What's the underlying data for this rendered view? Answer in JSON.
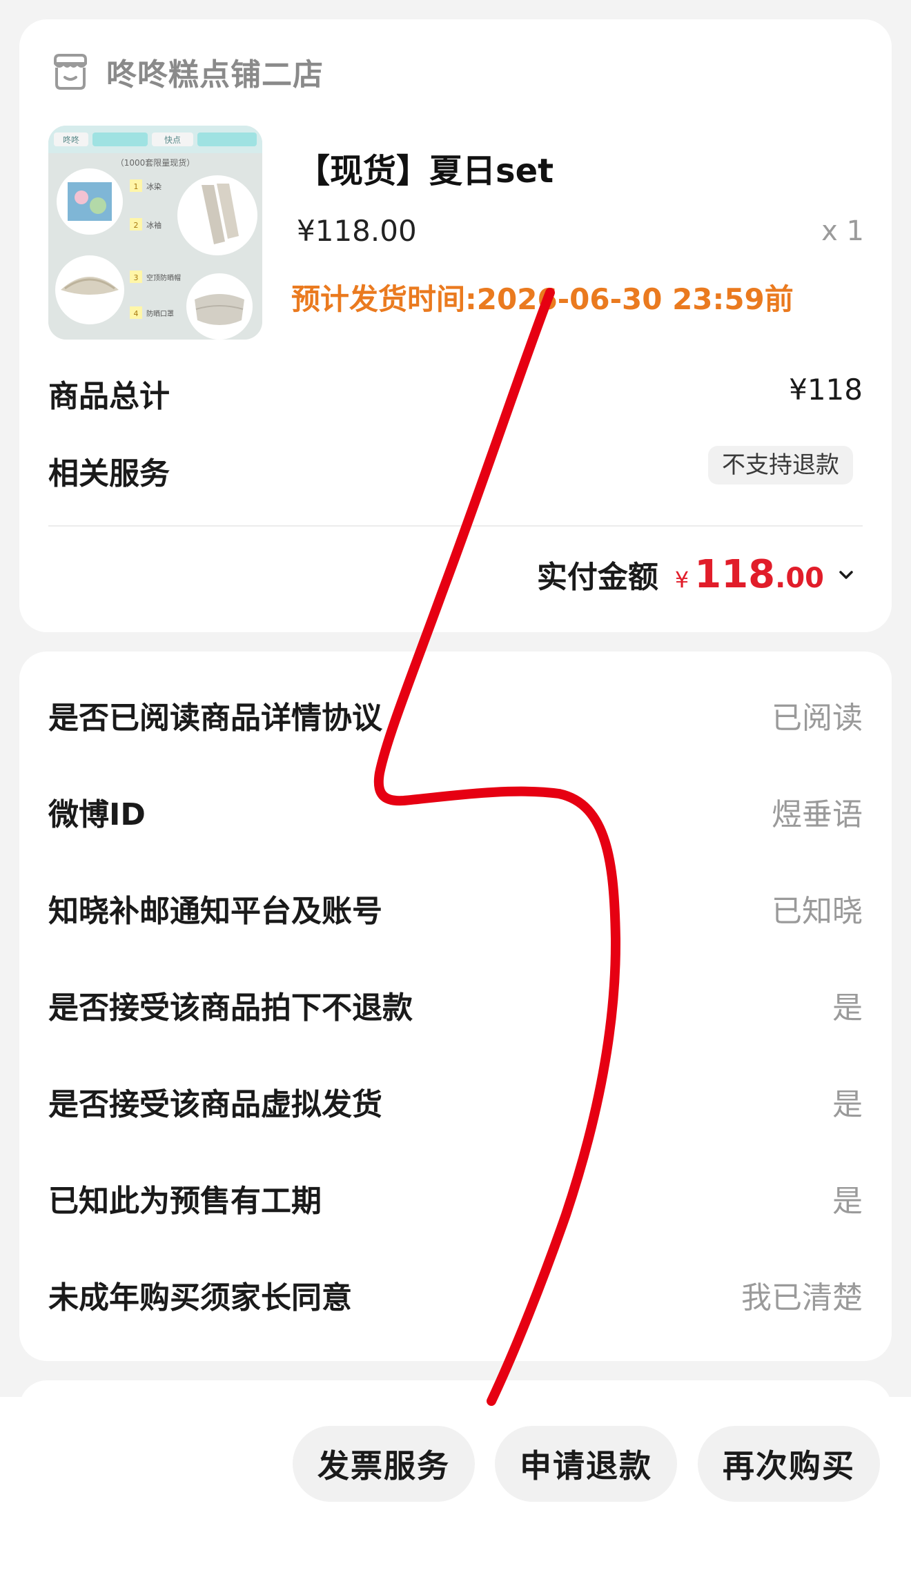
{
  "shop": {
    "name": "咚咚糕点铺二店",
    "icon": "shop-icon"
  },
  "product": {
    "title": "【现货】夏日set",
    "price": "¥118.00",
    "quantity": "x 1",
    "ship_time": "预计发货时间:2026-06-30 23:59前",
    "thumbnail": {
      "header_labels": [
        "咚咚",
        "",
        "快点",
        ""
      ],
      "caption": "（1000套限量现货）",
      "items": [
        {
          "num": "1",
          "label": "冰染"
        },
        {
          "num": "2",
          "label": "冰袖"
        },
        {
          "num": "3",
          "label": "空顶防晒帽"
        },
        {
          "num": "4",
          "label": "防晒口罩"
        }
      ]
    }
  },
  "summary": {
    "total_label": "商品总计",
    "total_value": "¥118",
    "service_label": "相关服务",
    "service_tag": "不支持退款",
    "paid_label": "实付金额",
    "paid_currency": "¥",
    "paid_int": "118",
    "paid_dec": ".00",
    "chevron_icon": "chevron-down-icon"
  },
  "info_rows": [
    {
      "label": "是否已阅读商品详情协议",
      "value": "已阅读"
    },
    {
      "label": "微博ID",
      "value": "煜垂语"
    },
    {
      "label": "知晓补邮通知平台及账号",
      "value": "已知晓"
    },
    {
      "label": "是否接受该商品拍下不退款",
      "value": "是"
    },
    {
      "label": "是否接受该商品虚拟发货",
      "value": "是"
    },
    {
      "label": "已知此为预售有工期",
      "value": "是"
    },
    {
      "label": "未成年购买须家长同意",
      "value": "我已清楚"
    }
  ],
  "actions": {
    "invoice": "发票服务",
    "refund": "申请退款",
    "rebuy": "再次购买"
  },
  "colors": {
    "accent_red": "#e11d2a",
    "ship_orange": "#ea7a1f",
    "scribble_red": "#e60012"
  }
}
